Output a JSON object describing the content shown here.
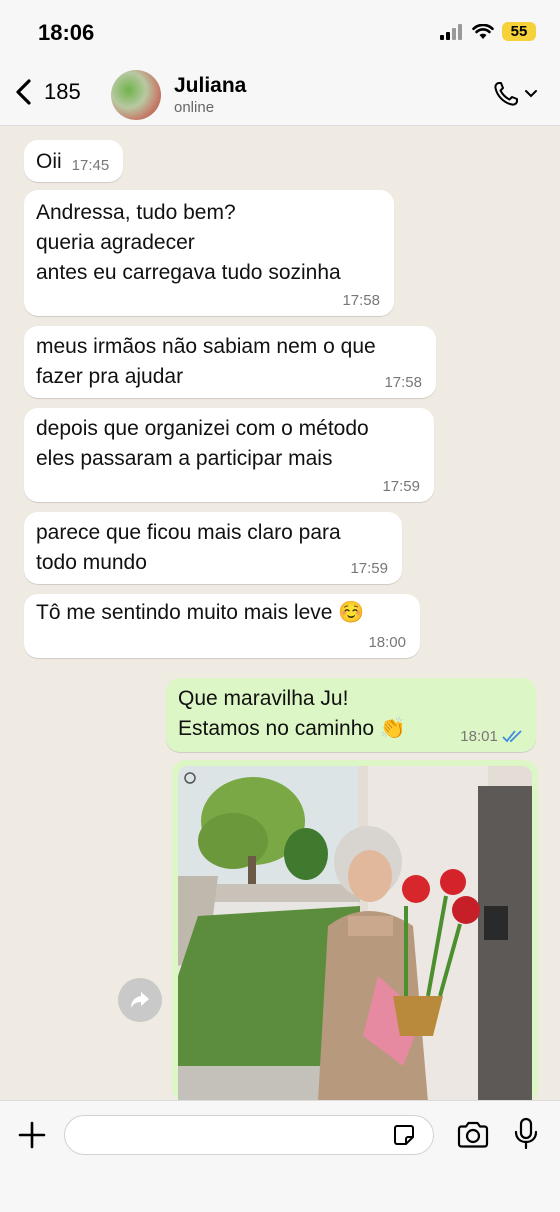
{
  "status": {
    "time": "18:06",
    "battery": "55"
  },
  "header": {
    "back_count": "185",
    "name": "Juliana",
    "status": "online"
  },
  "messages": [
    {
      "text": "Oii",
      "time": "17:45"
    },
    {
      "text": "Andressa, tudo bem?\nqueria agradecer\nantes eu carregava tudo sozinha",
      "time": "17:58"
    },
    {
      "text": "meus irmãos não sabiam nem o que\nfazer pra ajudar",
      "time": "17:58"
    },
    {
      "text": "depois que organizei com o método\neles passaram a participar mais",
      "time": "17:59"
    },
    {
      "text": "parece que ficou mais claro para\ntodo mundo",
      "time": "17:59"
    },
    {
      "text": "Tô me sentindo muito mais leve ☺️",
      "time": "18:00"
    },
    {
      "text": "Que maravilha Ju!\nEstamos no caminho 👏",
      "time": "18:01"
    }
  ],
  "colors": {
    "incoming": "#ffffff",
    "outgoing": "#dcf7c5",
    "read_ticks": "#3d8be0",
    "battery": "#f5d23a"
  },
  "icons": [
    "back-chevron-icon",
    "phone-icon",
    "chevron-down-icon",
    "forward-icon",
    "plus-icon",
    "sticker-icon",
    "camera-icon",
    "mic-icon"
  ]
}
